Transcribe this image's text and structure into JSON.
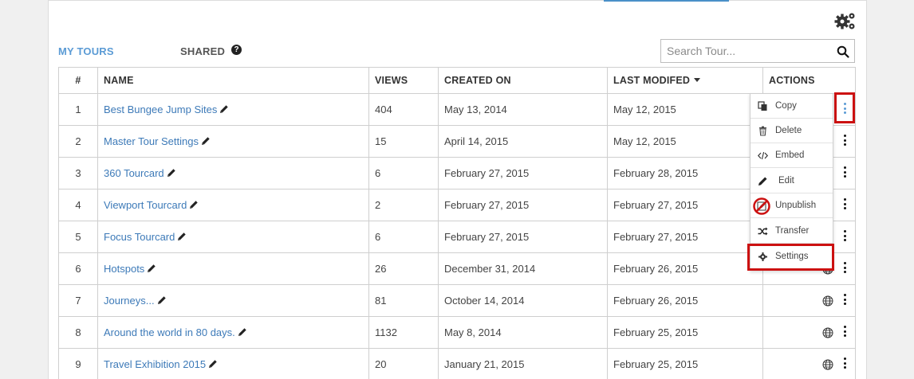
{
  "tabs": {
    "my_tours": "MY TOURS",
    "shared": "SHARED",
    "help": "?"
  },
  "search": {
    "placeholder": "Search Tour..."
  },
  "columns": {
    "num": "#",
    "name": "NAME",
    "views": "VIEWS",
    "created": "CREATED ON",
    "modified": "LAST MODIFED",
    "actions": "ACTIONS"
  },
  "rows": [
    {
      "num": "1",
      "name": "Best Bungee Jump Sites",
      "views": "404",
      "created": "May 13, 2014",
      "modified": "May 12, 2015"
    },
    {
      "num": "2",
      "name": "Master Tour Settings",
      "views": "15",
      "created": "April 14, 2015",
      "modified": "May 12, 2015"
    },
    {
      "num": "3",
      "name": "360 Tourcard",
      "views": "6",
      "created": "February 27, 2015",
      "modified": "February 28, 2015"
    },
    {
      "num": "4",
      "name": "Viewport Tourcard",
      "views": "2",
      "created": "February 27, 2015",
      "modified": "February 27, 2015"
    },
    {
      "num": "5",
      "name": "Focus Tourcard",
      "views": "6",
      "created": "February 27, 2015",
      "modified": "February 27, 2015"
    },
    {
      "num": "6",
      "name": "Hotspots",
      "views": "26",
      "created": "December 31, 2014",
      "modified": "February 26, 2015"
    },
    {
      "num": "7",
      "name": "Journeys...",
      "views": "81",
      "created": "October 14, 2014",
      "modified": "February 26, 2015"
    },
    {
      "num": "8",
      "name": "Around the world in 80 days.",
      "views": "1132",
      "created": "May 8, 2014",
      "modified": "February 25, 2015"
    },
    {
      "num": "9",
      "name": "Travel Exhibition 2015",
      "views": "20",
      "created": "January 21, 2015",
      "modified": "February 25, 2015"
    }
  ],
  "menu": {
    "copy": "Copy",
    "delete": "Delete",
    "embed": "Embed",
    "edit": "Edit",
    "unpublish": "Unpublish",
    "transfer": "Transfer",
    "settings": "Settings"
  },
  "colors": {
    "accent": "#5b9bd5",
    "link": "#3d7ab8",
    "highlight": "#cc1111"
  }
}
